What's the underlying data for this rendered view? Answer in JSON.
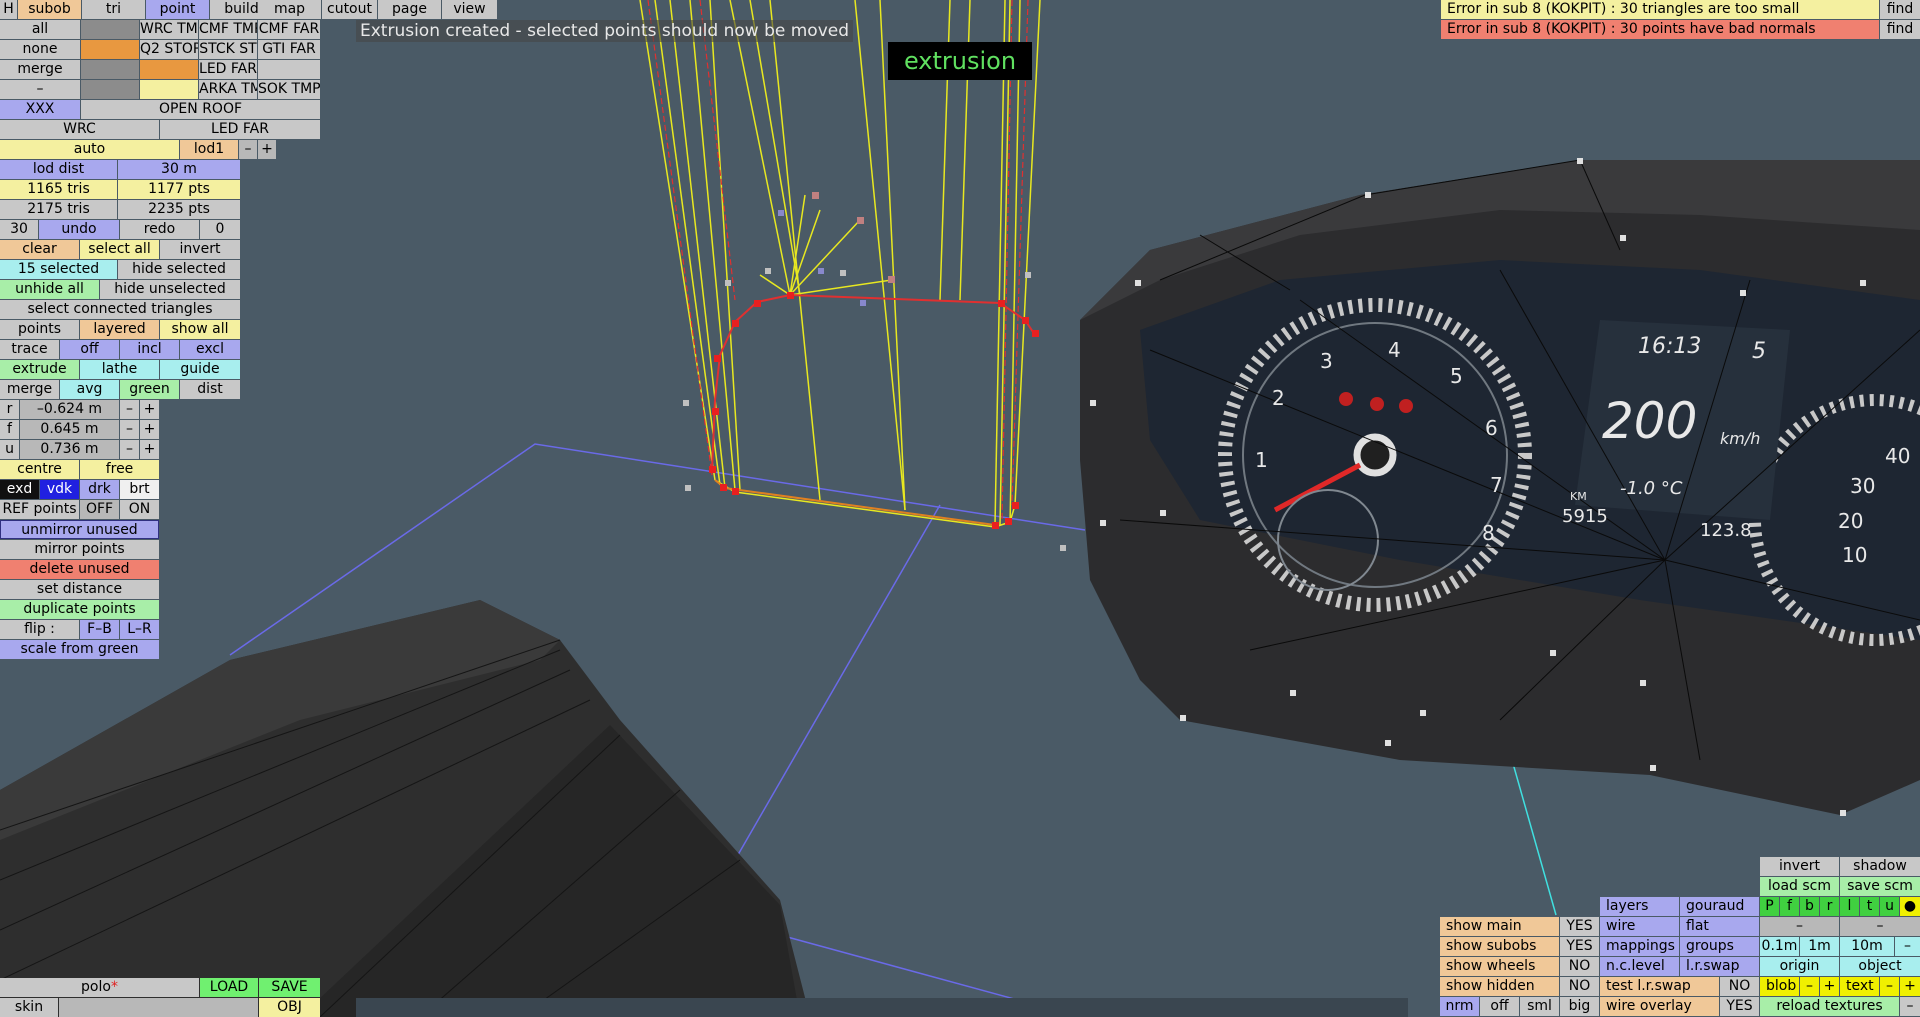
{
  "status_message": "Extrusion created - selected points should now be moved",
  "mode_label": "extrusion",
  "errors": [
    {
      "text": "Error in sub 8 (KOKPIT) : 30 triangles are too small",
      "find": "find"
    },
    {
      "text": "Error in sub 8 (KOKPIT) : 30 points have bad normals",
      "find": "find"
    }
  ],
  "menu": {
    "h": "H",
    "subob": "subob",
    "tri": "tri",
    "point": "point",
    "build": "build",
    "map": "map",
    "cutout": "cutout",
    "page": "page",
    "view": "view"
  },
  "grid": {
    "all": "all",
    "none": "none",
    "merge": "merge",
    "dash": "–",
    "xxx": "XXX",
    "wrc_tmp": "WRC TMP",
    "cmf_tmp": "CMF TMP",
    "cmf_far": "CMF FAR",
    "q2_stop": "Q2 STOP",
    "stck_st": "STCK ST",
    "gti_far": "GTI FAR",
    "led_far": "LED FAR",
    "arka_tm": "ARKA TM",
    "sok_tmp": "SOK TMP",
    "open_roof": "OPEN ROOF",
    "wrc": "WRC",
    "led_far2": "LED FAR",
    "auto": "auto",
    "lod1": "lod1",
    "minus": "–",
    "plus": "+"
  },
  "stats": {
    "lod_dist": "lod dist",
    "lod_dist_val": "30 m",
    "tris1": "1165 tris",
    "pts1": "1177 pts",
    "tris2": "2175 tris",
    "pts2": "2235 pts"
  },
  "tools": {
    "n30": "30",
    "undo": "undo",
    "redo": "redo",
    "n0": "0",
    "clear": "clear",
    "select_all": "select all",
    "invert": "invert",
    "selected": "15 selected",
    "hide_selected": "hide selected",
    "unhide_all": "unhide all",
    "hide_unselected": "hide unselected",
    "select_connected": "select connected triangles",
    "points": "points",
    "layered": "layered",
    "show_all": "show all",
    "trace": "trace",
    "off": "off",
    "incl": "incl",
    "excl": "excl",
    "extrude": "extrude",
    "lathe": "lathe",
    "guide": "guide",
    "merge": "merge",
    "avg": "avg",
    "green": "green",
    "dist": "dist",
    "r": "r",
    "r_val": "–0.624 m",
    "f": "f",
    "f_val": "0.645 m",
    "u": "u",
    "u_val": "0.736 m",
    "centre": "centre",
    "free": "free",
    "exd": "exd",
    "vdk": "vdk",
    "drk": "drk",
    "brt": "brt",
    "ref_points": "REF points",
    "ref_off": "OFF",
    "ref_on": "ON",
    "unmirror": "unmirror unused",
    "mirror": "mirror points",
    "delete_unused": "delete unused",
    "set_distance": "set distance",
    "duplicate": "duplicate points",
    "flip": "flip :",
    "fb": "F–B",
    "lr": "L–R",
    "scale_green": "scale from green"
  },
  "file": {
    "name": "polo",
    "modified": "*",
    "load": "LOAD",
    "save": "SAVE",
    "skin": "skin",
    "obj": "OBJ"
  },
  "right": {
    "invert": "invert",
    "shadow": "shadow",
    "load_scm": "load scm",
    "save_scm": "save scm",
    "layers": "layers",
    "gouraud": "gouraud",
    "show_main": "show main",
    "show_main_v": "YES",
    "wire": "wire",
    "flat": "flat",
    "show_subobs": "show subobs",
    "show_subobs_v": "YES",
    "mappings": "mappings",
    "groups": "groups",
    "g01": "0.1m",
    "g1": "1m",
    "g10": "10m",
    "show_wheels": "show wheels",
    "show_wheels_v": "NO",
    "nclevel": "n.c.level",
    "lrswap": "l.r.swap",
    "origin": "origin",
    "object": "object",
    "show_hidden": "show hidden",
    "show_hidden_v": "NO",
    "test_lr": "test l.r.swap",
    "test_lr_v": "NO",
    "blob": "blob",
    "text": "text",
    "nrm": "nrm",
    "off": "off",
    "sml": "sml",
    "big": "big",
    "wire_overlay": "wire overlay",
    "wire_overlay_v": "YES",
    "reload": "reload textures",
    "pf": [
      "P",
      "f",
      "b",
      "r",
      "l",
      "t",
      "u",
      "●"
    ]
  },
  "gauge": {
    "time": "16:13",
    "gear": "5",
    "speed": "200",
    "speed_unit": "km/h",
    "temp": "-1.0 °C",
    "odo_km": "KM",
    "odo": "5915",
    "trip": "123.8",
    "nums_left": [
      "1",
      "2",
      "3",
      "4",
      "5",
      "6",
      "7",
      "8"
    ],
    "nums_right": [
      "10",
      "20",
      "30",
      "40"
    ]
  },
  "colors": {
    "bg": "#4a5a66"
  }
}
